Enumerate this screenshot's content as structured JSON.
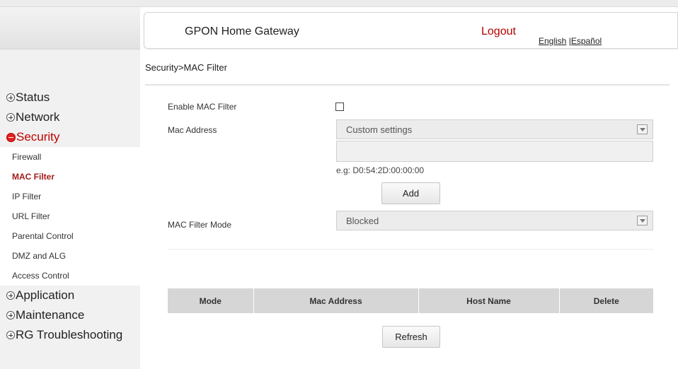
{
  "header": {
    "title": "GPON Home Gateway",
    "logout": "Logout",
    "lang_english": "English",
    "lang_separator": " |",
    "lang_spanish": "Español"
  },
  "breadcrumb": "Security>MAC Filter",
  "sidebar": {
    "groups": [
      {
        "label": "Status",
        "expanded": false
      },
      {
        "label": "Network",
        "expanded": false
      },
      {
        "label": "Security",
        "expanded": true,
        "items": [
          {
            "label": "Firewall",
            "active": false
          },
          {
            "label": "MAC Filter",
            "active": true
          },
          {
            "label": "IP Filter",
            "active": false
          },
          {
            "label": "URL Filter",
            "active": false
          },
          {
            "label": "Parental Control",
            "active": false
          },
          {
            "label": "DMZ and ALG",
            "active": false
          },
          {
            "label": "Access Control",
            "active": false
          }
        ]
      },
      {
        "label": "Application",
        "expanded": false
      },
      {
        "label": "Maintenance",
        "expanded": false
      },
      {
        "label": "RG Troubleshooting",
        "expanded": false
      }
    ]
  },
  "form": {
    "enable_label": "Enable MAC Filter",
    "enable_checked": false,
    "mac_address_label": "Mac Address",
    "mac_select_value": "Custom settings",
    "mac_input_value": "",
    "mac_hint": "e.g: D0:54:2D:00:00:00",
    "add_button": "Add",
    "mode_label": "MAC Filter Mode",
    "mode_select_value": "Blocked"
  },
  "table": {
    "columns": [
      "Mode",
      "Mac Address",
      "Host Name",
      "Delete"
    ],
    "rows": []
  },
  "refresh_button": "Refresh",
  "colors": {
    "accent_red": "#b30000",
    "active_menu": "#a51c1c",
    "table_header_bg": "#d6d6d6"
  }
}
